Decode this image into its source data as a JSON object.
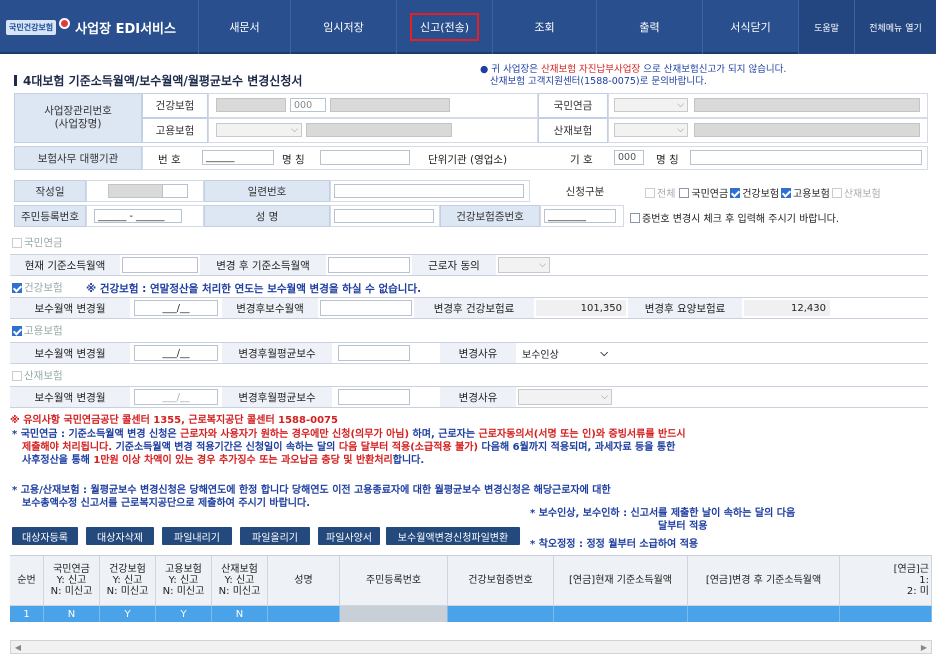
{
  "header": {
    "logo_org": "국민건강보험",
    "app_name": "사업장 EDI서비스",
    "menu": [
      "새문서",
      "임시저장",
      "신고(전송)",
      "조회",
      "출력",
      "서식닫기"
    ],
    "help": "도움말",
    "all_menu": "전체메뉴 열기"
  },
  "page": {
    "title": "4대보험 기준소득월액/보수월액/월평균보수 변경신청서",
    "notice_l1_a": "● 귀 사업장은 ",
    "notice_l1_b": "산재보험 자진납부사업장",
    "notice_l1_c": " 으로 산재보험신고가 되지 않습니다.",
    "notice_l2": "산재보험 고객지원센터(1588-0075)로 문의바랍니다."
  },
  "form": {
    "workplace_no_label": "사업장관리번호\n(사업장명)",
    "health": "건강보험",
    "health_code": "000",
    "pension": "국민연금",
    "employment": "고용보험",
    "industrial": "산재보험",
    "agency_label": "보험사무 대행기관",
    "number": "번 호",
    "number_mask": "______",
    "name_label": "명 칭",
    "unit_label": "단위기관 (영업소)",
    "code_label": "기 호",
    "unit_code": "000",
    "unit_name_label": "명 칭",
    "date_label": "작성일",
    "serial_label": "일련번호",
    "type_label": "신청구분",
    "type_all": "전체",
    "type_pension": "국민연금",
    "type_health": "건강보험",
    "type_employment": "고용보험",
    "type_industrial": "산재보험",
    "rrn_label": "주민등록번호",
    "rrn_mask": "______ - ______",
    "person_name_label": "성 명",
    "health_card_label": "건강보험증번호",
    "health_card_mask": "________",
    "card_change_note": "증번호 변경시 체크 후 입력해 주시기 바랍니다."
  },
  "pension_sec": {
    "title": "국민연금",
    "current": "현재 기준소득월액",
    "after": "변경 후 기준소득월액",
    "consent": "근로자 동의"
  },
  "health_sec": {
    "title": "건강보험",
    "warn": "※ 건강보험 : 연말정산을 처리한 연도는 보수월액 변경을 하실 수 없습니다.",
    "change_month": "보수월액 변경월",
    "month_mask": "___/__",
    "after_wage": "변경후보수월액",
    "after_premium": "변경후 건강보험료",
    "premium_value": "101,350",
    "after_ltc": "변경후 요양보험료",
    "ltc_value": "12,430"
  },
  "emp_sec": {
    "title": "고용보험",
    "change_month": "보수월액 변경월",
    "month_mask": "___/__",
    "after_avg": "변경후월평균보수",
    "reason": "변경사유",
    "reason_value": "보수인상"
  },
  "ind_sec": {
    "title": "산재보험",
    "change_month": "보수월액 변경월",
    "month_mask": "___/__",
    "after_avg": "변경후월평균보수",
    "reason": "변경사유"
  },
  "notes": {
    "head_a": "※ 유의사항 ",
    "head_b": " 국민연금공단 콜센터 1355, 근로복지공단 콜센터 1588-0075",
    "p1_l1_a": "* 국민연금 : 기준소득월액 변경 신청은 ",
    "p1_l1_b": "근로자와 사용자가 원하는 경우에만 신청(의무가 아님)",
    "p1_l1_c": " 하며, 근로자는 ",
    "p1_l1_d": "근로자동의서(서명 또는 인)와 증빙서류를 반드시",
    "p1_l2_a": "제출해야 처리됩니다.",
    "p1_l2_b": " 기준소득월액 변경 적용기간은 신청일이 속하는 달의 ",
    "p1_l2_c": "다음 달부터 적용(소급적용 불가)",
    "p1_l2_d": " 다음해 6월까지 적용되며, 과세자료 등을 통한",
    "p1_l3_a": "사후정산을 통해 ",
    "p1_l3_b": "1만원 이상 차액이 있는 경우 추가징수 또는 과오납금 충당 및 반환처리",
    "p1_l3_c": "합니다.",
    "p2_l1": "* 고용/산재보험 : 월평균보수 변경신청은 당해연도에 한정 합니다 당해연도 이전 고용종료자에 대한 월평균보수 변경신청은 해당근로자에 대한",
    "p2_l2": "보수총액수정 신고서를 근로복지공단으로 제출하여 주시기 바랍니다.",
    "side1_l1": "* 보수인상, 보수인하 : 신고서를 제출한 날이 속하는 달의 다음",
    "side1_l2": "달부터 적용",
    "side2": "* 착오정정 : 정정 월부터 소급하여 적용"
  },
  "buttons": [
    "대상자등록",
    "대상자삭제",
    "파일내리기",
    "파일올리기",
    "파일사양서",
    "보수월액변경신청파일변환"
  ],
  "table": {
    "headers": [
      "순번",
      "국민연금\nY: 신고\nN: 미신고",
      "건강보험\nY: 신고\nN: 미신고",
      "고용보험\nY: 신고\nN: 미신고",
      "산재보험\nY: 신고\nN: 미신고",
      "성명",
      "주민등록번호",
      "건강보험증번호",
      "[연금]현재 기준소득월액",
      "[연금]변경 후 기준소득월액",
      "[연금]근\n1:\n2: 미"
    ],
    "row": [
      "1",
      "N",
      "Y",
      "Y",
      "N"
    ]
  }
}
